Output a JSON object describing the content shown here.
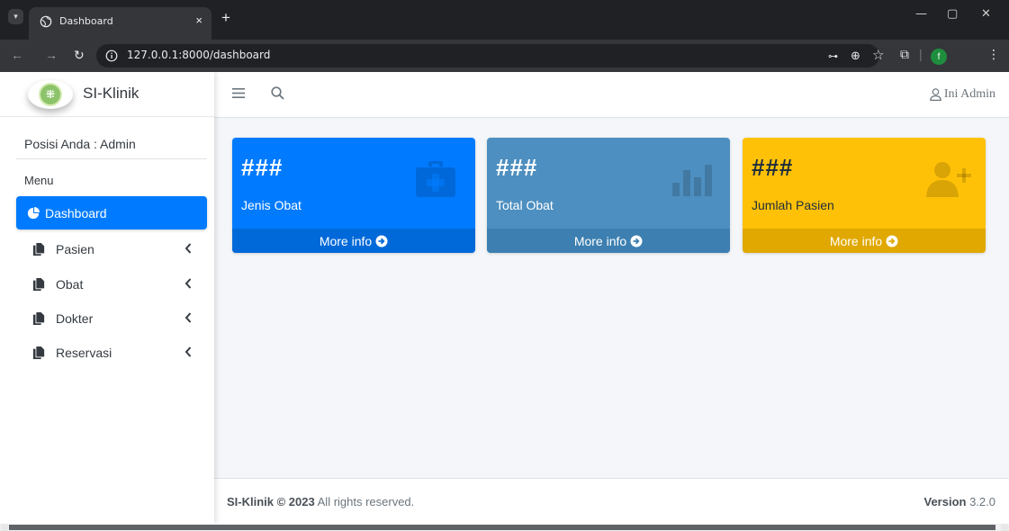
{
  "browser": {
    "tab_title": "Dashboard",
    "tab_close": "×",
    "new_tab": "+",
    "url": "127.0.0.1:8000/dashboard",
    "profile_initial": "f",
    "window_controls": {
      "minimize": "—",
      "restore": "▢",
      "close": "✕"
    }
  },
  "sidebar": {
    "brand": "SI-Klinik",
    "user_panel": "Posisi Anda : Admin",
    "menu_header": "Menu",
    "items": [
      {
        "label": "Dashboard",
        "icon": "dashboard-icon",
        "active": true
      },
      {
        "label": "Pasien",
        "icon": "file-icon"
      },
      {
        "label": "Obat",
        "icon": "file-icon"
      },
      {
        "label": "Dokter",
        "icon": "file-icon"
      },
      {
        "label": "Reservasi",
        "icon": "file-icon"
      }
    ]
  },
  "header": {
    "user": "Ini Admin"
  },
  "cards": [
    {
      "value": "###",
      "label": "Jenis Obat",
      "footer": "More info",
      "icon": "medkit-icon"
    },
    {
      "value": "###",
      "label": "Total Obat",
      "footer": "More info",
      "icon": "bar-chart-icon"
    },
    {
      "value": "###",
      "label": "Jumlah Pasien",
      "footer": "More info",
      "icon": "user-plus-icon"
    }
  ],
  "footer": {
    "brand": "SI-Klinik © 2023",
    "rights": " All rights reserved.",
    "version_label": "Version",
    "version": " 3.2.0"
  },
  "colors": {
    "primary": "#007bff",
    "steel": "#4d8fc0",
    "warning": "#ffc107"
  }
}
